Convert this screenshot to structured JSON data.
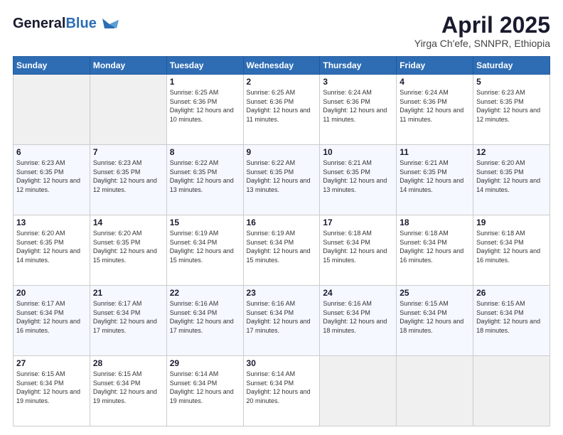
{
  "header": {
    "logo_line1": "General",
    "logo_line2": "Blue",
    "month": "April 2025",
    "location": "Yirga Ch'efe, SNNPR, Ethiopia"
  },
  "days_of_week": [
    "Sunday",
    "Monday",
    "Tuesday",
    "Wednesday",
    "Thursday",
    "Friday",
    "Saturday"
  ],
  "weeks": [
    [
      {
        "day": "",
        "sunrise": "",
        "sunset": "",
        "daylight": ""
      },
      {
        "day": "",
        "sunrise": "",
        "sunset": "",
        "daylight": ""
      },
      {
        "day": "1",
        "sunrise": "Sunrise: 6:25 AM",
        "sunset": "Sunset: 6:36 PM",
        "daylight": "Daylight: 12 hours and 10 minutes."
      },
      {
        "day": "2",
        "sunrise": "Sunrise: 6:25 AM",
        "sunset": "Sunset: 6:36 PM",
        "daylight": "Daylight: 12 hours and 11 minutes."
      },
      {
        "day": "3",
        "sunrise": "Sunrise: 6:24 AM",
        "sunset": "Sunset: 6:36 PM",
        "daylight": "Daylight: 12 hours and 11 minutes."
      },
      {
        "day": "4",
        "sunrise": "Sunrise: 6:24 AM",
        "sunset": "Sunset: 6:36 PM",
        "daylight": "Daylight: 12 hours and 11 minutes."
      },
      {
        "day": "5",
        "sunrise": "Sunrise: 6:23 AM",
        "sunset": "Sunset: 6:35 PM",
        "daylight": "Daylight: 12 hours and 12 minutes."
      }
    ],
    [
      {
        "day": "6",
        "sunrise": "Sunrise: 6:23 AM",
        "sunset": "Sunset: 6:35 PM",
        "daylight": "Daylight: 12 hours and 12 minutes."
      },
      {
        "day": "7",
        "sunrise": "Sunrise: 6:23 AM",
        "sunset": "Sunset: 6:35 PM",
        "daylight": "Daylight: 12 hours and 12 minutes."
      },
      {
        "day": "8",
        "sunrise": "Sunrise: 6:22 AM",
        "sunset": "Sunset: 6:35 PM",
        "daylight": "Daylight: 12 hours and 13 minutes."
      },
      {
        "day": "9",
        "sunrise": "Sunrise: 6:22 AM",
        "sunset": "Sunset: 6:35 PM",
        "daylight": "Daylight: 12 hours and 13 minutes."
      },
      {
        "day": "10",
        "sunrise": "Sunrise: 6:21 AM",
        "sunset": "Sunset: 6:35 PM",
        "daylight": "Daylight: 12 hours and 13 minutes."
      },
      {
        "day": "11",
        "sunrise": "Sunrise: 6:21 AM",
        "sunset": "Sunset: 6:35 PM",
        "daylight": "Daylight: 12 hours and 14 minutes."
      },
      {
        "day": "12",
        "sunrise": "Sunrise: 6:20 AM",
        "sunset": "Sunset: 6:35 PM",
        "daylight": "Daylight: 12 hours and 14 minutes."
      }
    ],
    [
      {
        "day": "13",
        "sunrise": "Sunrise: 6:20 AM",
        "sunset": "Sunset: 6:35 PM",
        "daylight": "Daylight: 12 hours and 14 minutes."
      },
      {
        "day": "14",
        "sunrise": "Sunrise: 6:20 AM",
        "sunset": "Sunset: 6:35 PM",
        "daylight": "Daylight: 12 hours and 15 minutes."
      },
      {
        "day": "15",
        "sunrise": "Sunrise: 6:19 AM",
        "sunset": "Sunset: 6:34 PM",
        "daylight": "Daylight: 12 hours and 15 minutes."
      },
      {
        "day": "16",
        "sunrise": "Sunrise: 6:19 AM",
        "sunset": "Sunset: 6:34 PM",
        "daylight": "Daylight: 12 hours and 15 minutes."
      },
      {
        "day": "17",
        "sunrise": "Sunrise: 6:18 AM",
        "sunset": "Sunset: 6:34 PM",
        "daylight": "Daylight: 12 hours and 15 minutes."
      },
      {
        "day": "18",
        "sunrise": "Sunrise: 6:18 AM",
        "sunset": "Sunset: 6:34 PM",
        "daylight": "Daylight: 12 hours and 16 minutes."
      },
      {
        "day": "19",
        "sunrise": "Sunrise: 6:18 AM",
        "sunset": "Sunset: 6:34 PM",
        "daylight": "Daylight: 12 hours and 16 minutes."
      }
    ],
    [
      {
        "day": "20",
        "sunrise": "Sunrise: 6:17 AM",
        "sunset": "Sunset: 6:34 PM",
        "daylight": "Daylight: 12 hours and 16 minutes."
      },
      {
        "day": "21",
        "sunrise": "Sunrise: 6:17 AM",
        "sunset": "Sunset: 6:34 PM",
        "daylight": "Daylight: 12 hours and 17 minutes."
      },
      {
        "day": "22",
        "sunrise": "Sunrise: 6:16 AM",
        "sunset": "Sunset: 6:34 PM",
        "daylight": "Daylight: 12 hours and 17 minutes."
      },
      {
        "day": "23",
        "sunrise": "Sunrise: 6:16 AM",
        "sunset": "Sunset: 6:34 PM",
        "daylight": "Daylight: 12 hours and 17 minutes."
      },
      {
        "day": "24",
        "sunrise": "Sunrise: 6:16 AM",
        "sunset": "Sunset: 6:34 PM",
        "daylight": "Daylight: 12 hours and 18 minutes."
      },
      {
        "day": "25",
        "sunrise": "Sunrise: 6:15 AM",
        "sunset": "Sunset: 6:34 PM",
        "daylight": "Daylight: 12 hours and 18 minutes."
      },
      {
        "day": "26",
        "sunrise": "Sunrise: 6:15 AM",
        "sunset": "Sunset: 6:34 PM",
        "daylight": "Daylight: 12 hours and 18 minutes."
      }
    ],
    [
      {
        "day": "27",
        "sunrise": "Sunrise: 6:15 AM",
        "sunset": "Sunset: 6:34 PM",
        "daylight": "Daylight: 12 hours and 19 minutes."
      },
      {
        "day": "28",
        "sunrise": "Sunrise: 6:15 AM",
        "sunset": "Sunset: 6:34 PM",
        "daylight": "Daylight: 12 hours and 19 minutes."
      },
      {
        "day": "29",
        "sunrise": "Sunrise: 6:14 AM",
        "sunset": "Sunset: 6:34 PM",
        "daylight": "Daylight: 12 hours and 19 minutes."
      },
      {
        "day": "30",
        "sunrise": "Sunrise: 6:14 AM",
        "sunset": "Sunset: 6:34 PM",
        "daylight": "Daylight: 12 hours and 20 minutes."
      },
      {
        "day": "",
        "sunrise": "",
        "sunset": "",
        "daylight": ""
      },
      {
        "day": "",
        "sunrise": "",
        "sunset": "",
        "daylight": ""
      },
      {
        "day": "",
        "sunrise": "",
        "sunset": "",
        "daylight": ""
      }
    ]
  ]
}
